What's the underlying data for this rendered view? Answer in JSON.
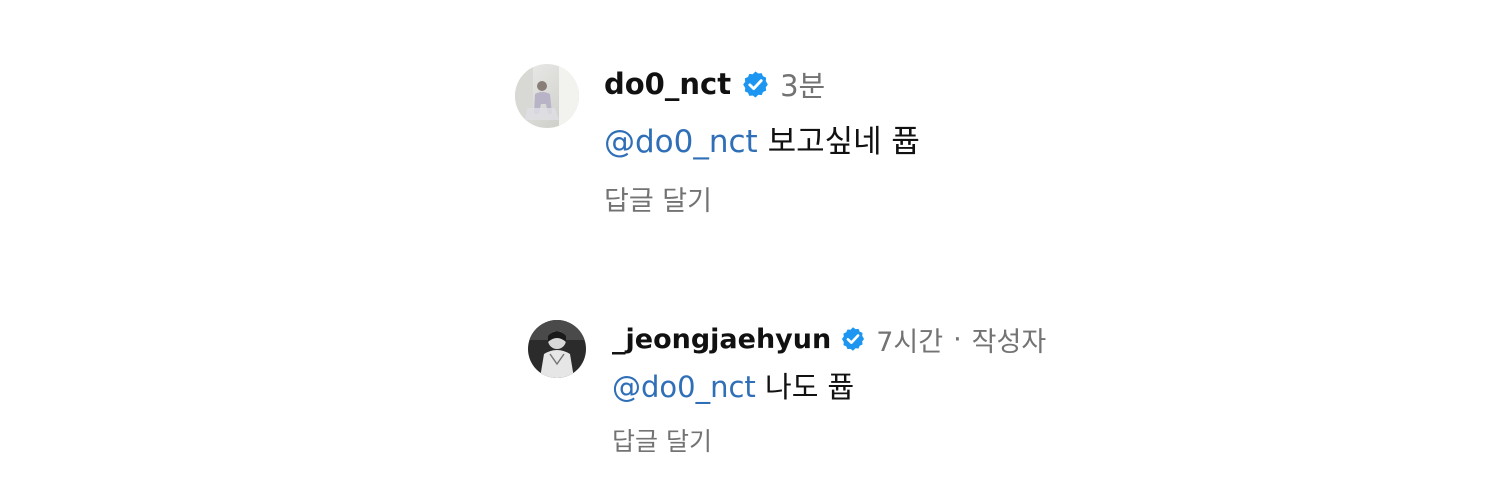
{
  "colors": {
    "text": "#111111",
    "muted": "#737373",
    "mention": "#2f6fb7",
    "verified_badge": "#1c96f0"
  },
  "comments": [
    {
      "avatar_icon": "profile-photo-avatar",
      "username": "do0_nct",
      "verified_icon": "verified-badge-icon",
      "time": "3분",
      "mention": "@do0_nct",
      "text": "보고싶네 퓹",
      "reply_label": "답글 달기"
    },
    {
      "avatar_icon": "profile-photo-avatar",
      "username": "_jeongjaehyun",
      "verified_icon": "verified-badge-icon",
      "time": "7시간",
      "separator": "·",
      "author_label": "작성자",
      "mention": "@do0_nct",
      "text": "나도 퓹",
      "reply_label": "답글 달기"
    }
  ]
}
